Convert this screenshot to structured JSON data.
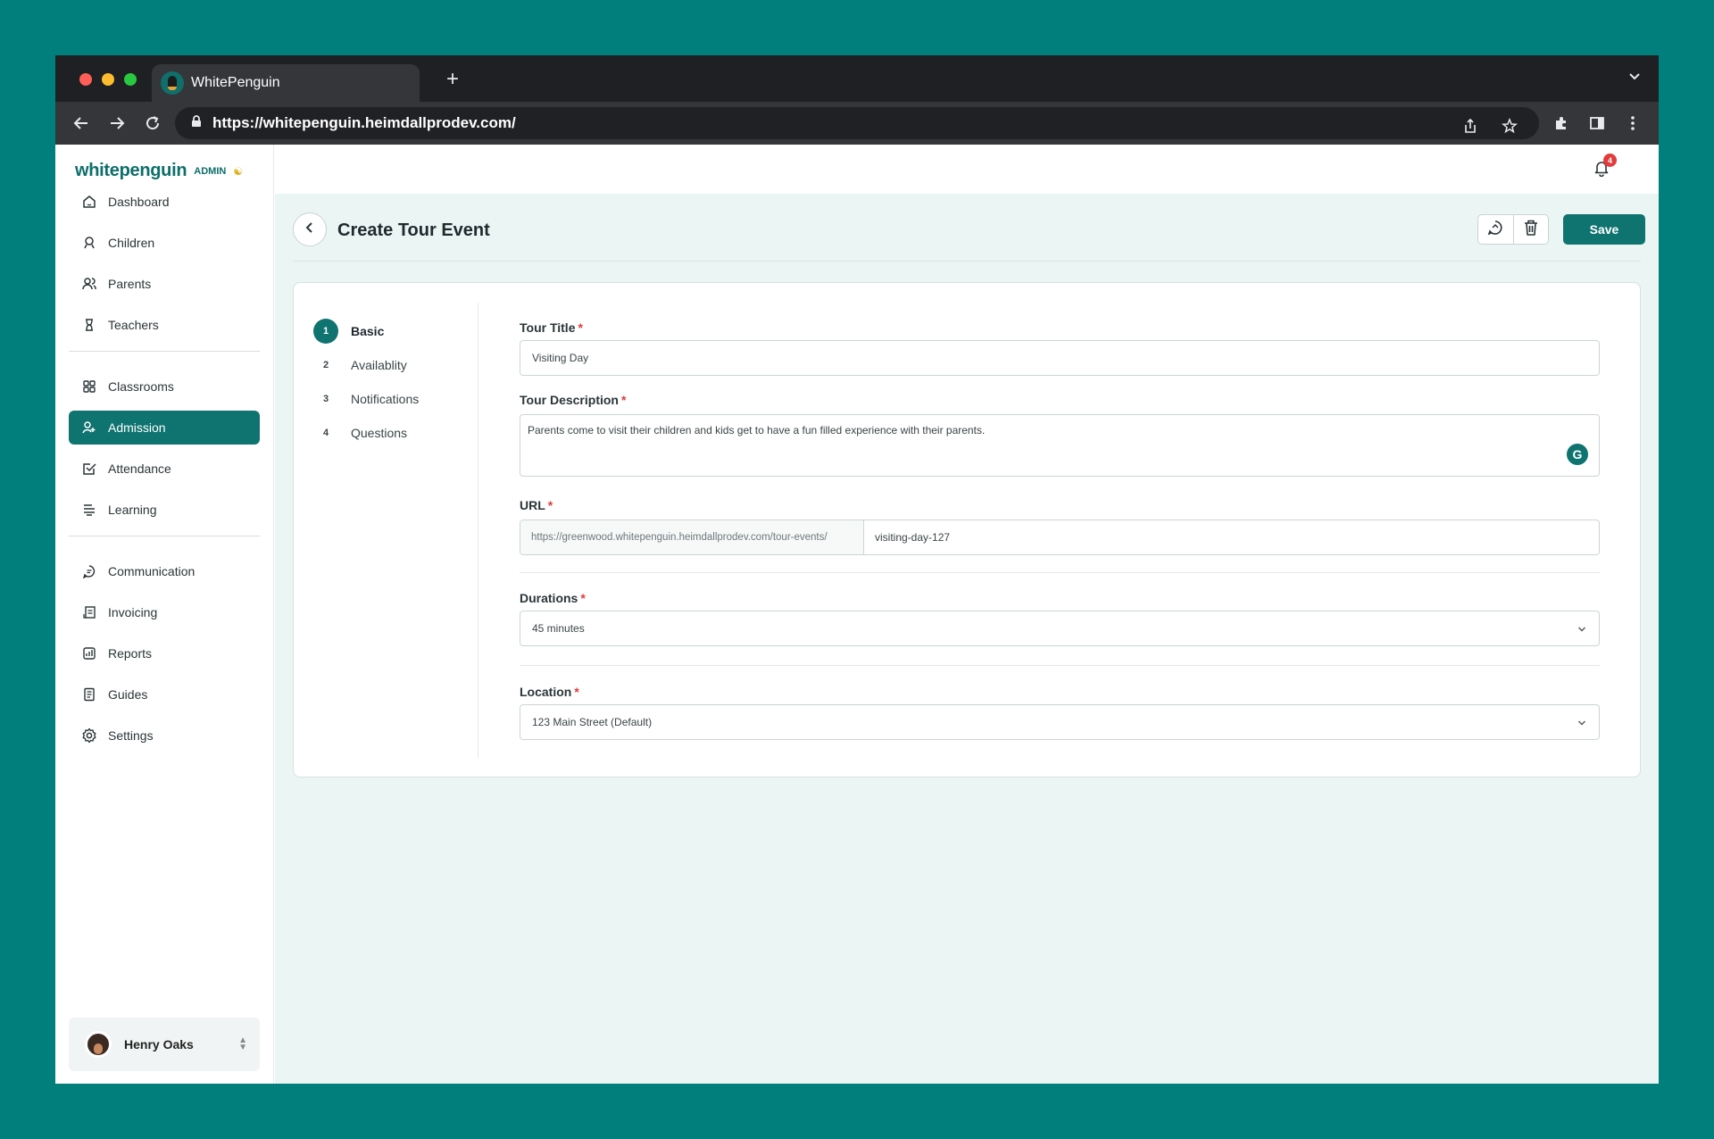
{
  "browser": {
    "tab_title": "WhitePenguin",
    "new_tab": "+",
    "url": "https://whitepenguin.heimdallprodev.com/"
  },
  "sidebar": {
    "brand": "whitepenguin",
    "brand_tag": "ADMIN",
    "groups": [
      [
        {
          "label": "Dashboard",
          "icon": "home-icon"
        },
        {
          "label": "Children",
          "icon": "child-icon"
        },
        {
          "label": "Parents",
          "icon": "parents-icon"
        },
        {
          "label": "Teachers",
          "icon": "teacher-icon"
        }
      ],
      [
        {
          "label": "Classrooms",
          "icon": "grid-icon"
        },
        {
          "label": "Admission",
          "icon": "user-plus-icon",
          "active": true
        },
        {
          "label": "Attendance",
          "icon": "check-icon"
        },
        {
          "label": "Learning",
          "icon": "book-icon"
        }
      ],
      [
        {
          "label": "Communication",
          "icon": "chat-icon"
        },
        {
          "label": "Invoicing",
          "icon": "invoice-icon"
        },
        {
          "label": "Reports",
          "icon": "chart-icon"
        },
        {
          "label": "Guides",
          "icon": "guide-icon"
        },
        {
          "label": "Settings",
          "icon": "gear-icon"
        }
      ]
    ],
    "user": {
      "name": "Henry Oaks"
    }
  },
  "header": {
    "notification_count": "4"
  },
  "page": {
    "title": "Create Tour Event",
    "save_label": "Save"
  },
  "steps": [
    {
      "num": "1",
      "label": "Basic",
      "active": true
    },
    {
      "num": "2",
      "label": "Availablity"
    },
    {
      "num": "3",
      "label": "Notifications"
    },
    {
      "num": "4",
      "label": "Questions"
    }
  ],
  "form": {
    "title_label": "Tour Title",
    "title_value": "Visiting Day",
    "desc_label": "Tour Description",
    "desc_value": "Parents come to visit their children and kids get to have a fun filled experience with their parents.",
    "url_label": "URL",
    "url_prefix": "https://greenwood.whitepenguin.heimdallprodev.com/tour-events/",
    "url_slug": "visiting-day-127",
    "duration_label": "Durations",
    "duration_value": "45 minutes",
    "location_label": "Location",
    "location_value": "123 Main Street (Default)",
    "required_mark": "*"
  },
  "colors": {
    "accent": "#0f7370",
    "background": "#007f7d",
    "required": "#e23b3b"
  }
}
